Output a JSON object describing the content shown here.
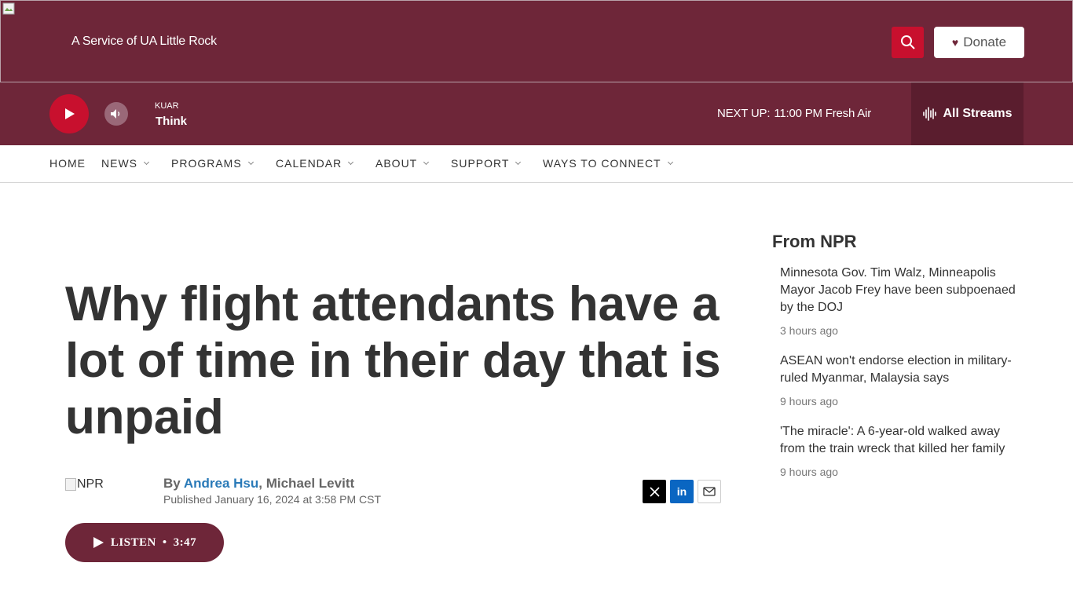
{
  "header": {
    "tagline": "A Service of UA Little Rock",
    "donate_label": "Donate"
  },
  "player": {
    "station": "KUAR",
    "show": "Think",
    "next_up_label": "NEXT UP:",
    "next_up_value": "11:00 PM Fresh Air",
    "streams_label": "All Streams"
  },
  "nav": {
    "items": [
      {
        "label": "HOME"
      },
      {
        "label": "NEWS"
      },
      {
        "label": "PROGRAMS"
      },
      {
        "label": "CALENDAR"
      },
      {
        "label": "ABOUT"
      },
      {
        "label": "SUPPORT"
      },
      {
        "label": "WAYS TO CONNECT"
      }
    ]
  },
  "article": {
    "headline": "Why flight attendants have a lot of time in their day that is unpaid",
    "logo_alt": "NPR",
    "byline_prefix": "By",
    "author_1": "Andrea Hsu",
    "author_separator": ",",
    "author_2": "Michael Levitt",
    "published": "Published January 16, 2024 at 3:58 PM CST",
    "share_linkedin": "in",
    "listen_label": "LISTEN",
    "listen_dot": "•",
    "listen_duration": "3:47"
  },
  "sidebar": {
    "title": "From NPR",
    "items": [
      {
        "title": "Minnesota Gov. Tim Walz, Minneapolis Mayor Jacob Frey have been subpoenaed by the DOJ",
        "time": "3 hours ago"
      },
      {
        "title": "ASEAN won't endorse election in military-ruled Myanmar, Malaysia says",
        "time": "9 hours ago"
      },
      {
        "title": "'The miracle': A 6-year-old walked away from the train wreck that killed her family",
        "time": "9 hours ago"
      }
    ]
  },
  "colors": {
    "brand": "#6e2639",
    "accent": "#c8102e",
    "link": "#2a7ab8"
  },
  "icons": [
    "broken-image-icon",
    "search-icon",
    "heart-icon",
    "play-icon",
    "volume-icon",
    "audio-wave-icon",
    "chevron-down-icon",
    "x-logo-icon",
    "linkedin-icon",
    "mail-icon"
  ]
}
